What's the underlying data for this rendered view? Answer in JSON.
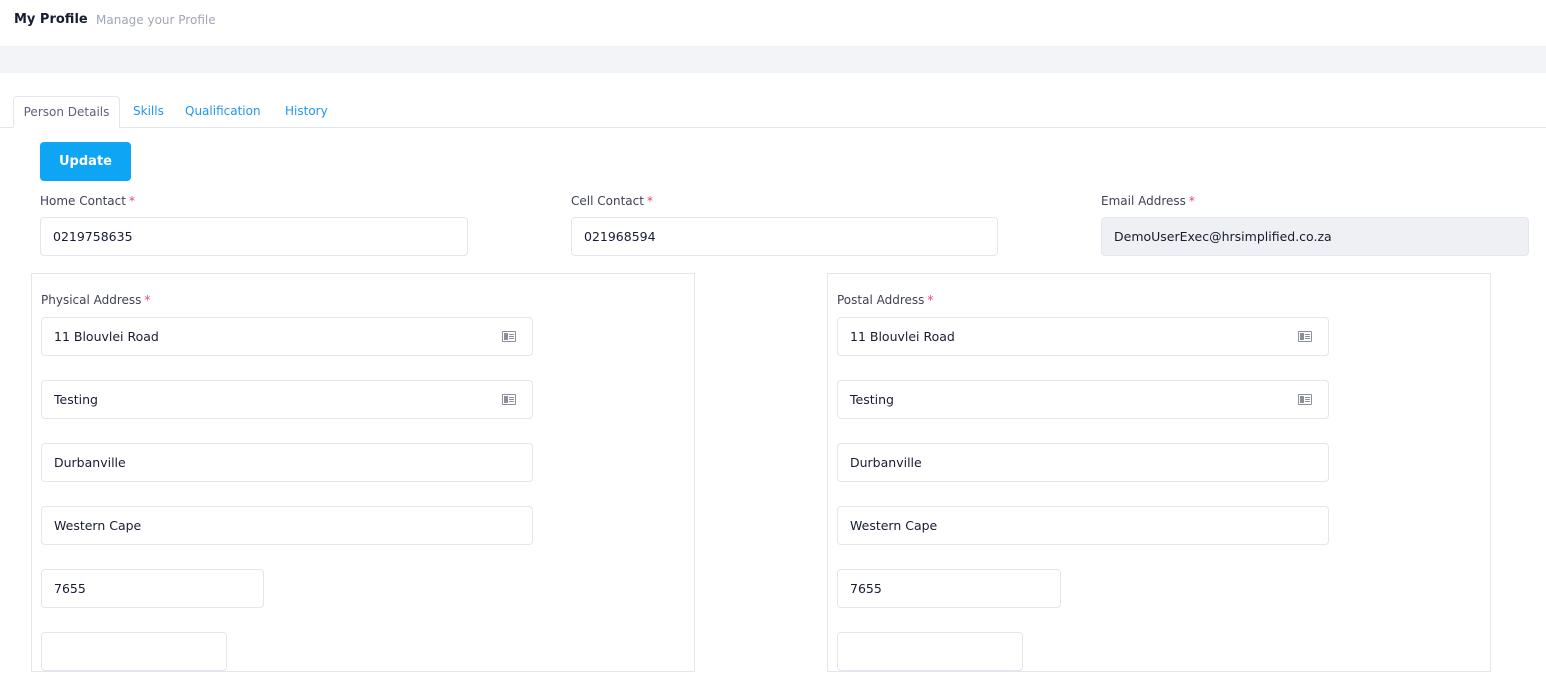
{
  "header": {
    "title": "My Profile",
    "subtitle": "Manage your Profile"
  },
  "tabs": [
    {
      "label": "Person Details",
      "active": true
    },
    {
      "label": "Skills",
      "active": false
    },
    {
      "label": "Qualification",
      "active": false
    },
    {
      "label": "History",
      "active": false
    }
  ],
  "actions": {
    "update_label": "Update"
  },
  "contact": {
    "home_label": "Home Contact",
    "home_value": "0219758635",
    "cell_label": "Cell Contact",
    "cell_value": "021968594",
    "email_label": "Email Address",
    "email_value": "DemoUserExec@hrsimplified.co.za",
    "required_marker": "*"
  },
  "physical_address": {
    "label": "Physical Address",
    "line1": "11 Blouvlei Road",
    "line2": "Testing",
    "city": "Durbanville",
    "province": "Western Cape",
    "postal_code": "7655",
    "extra": ""
  },
  "postal_address": {
    "label": "Postal Address",
    "line1": "11 Blouvlei Road",
    "line2": "Testing",
    "city": "Durbanville",
    "province": "Western Cape",
    "postal_code": "7655",
    "extra": ""
  },
  "icons": {
    "address_field_icon": "address-card-icon"
  },
  "colors": {
    "accent": "#0ea5f5",
    "tab_link": "#2196f3",
    "required": "#f1416c",
    "disabled_bg": "#eef0f3"
  }
}
